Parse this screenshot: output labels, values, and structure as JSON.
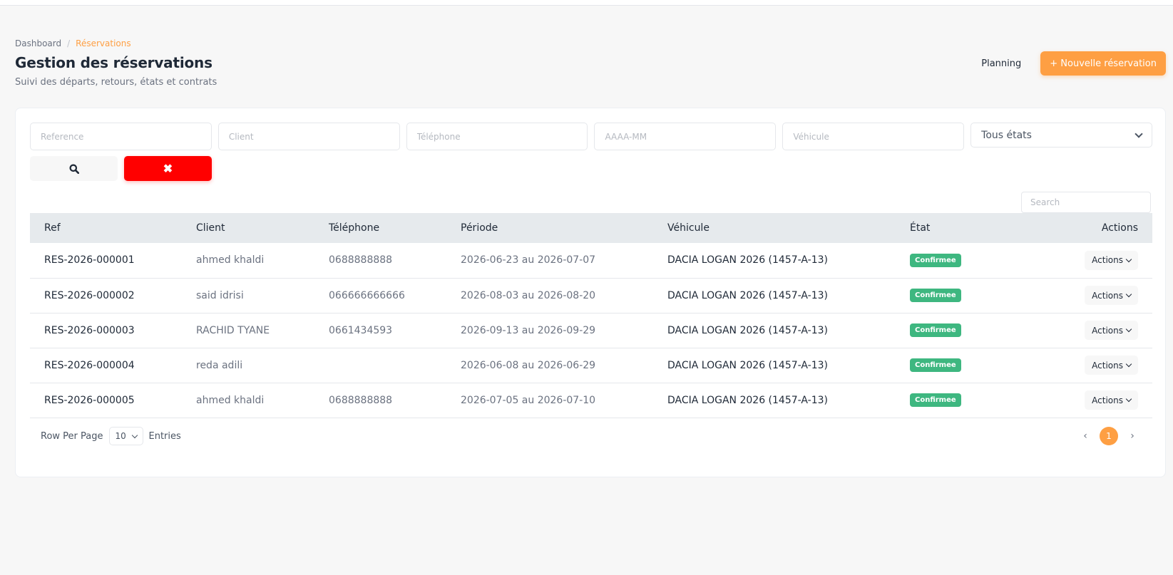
{
  "breadcrumb": {
    "home": "Dashboard",
    "separator": "/",
    "current": "Réservations"
  },
  "header": {
    "title": "Gestion des réservations",
    "subtitle": "Suivi des départs, retours, états et contrats",
    "planning_label": "Planning",
    "new_label": "+ Nouvelle réservation"
  },
  "filters": {
    "reference_placeholder": "Reference",
    "client_placeholder": "Client",
    "phone_placeholder": "Téléphone",
    "month_placeholder": "AAAA-MM",
    "vehicle_placeholder": "Véhicule",
    "state_value": "Tous états",
    "search_icon": "search-icon",
    "clear_icon": "close-icon",
    "clear_glyph": "✖"
  },
  "table": {
    "search_placeholder": "Search",
    "columns": [
      "Ref",
      "Client",
      "Téléphone",
      "Période",
      "Véhicule",
      "État",
      "Actions"
    ],
    "rows": [
      {
        "ref": "RES-2026-000001",
        "client": "ahmed khaldi",
        "phone": "0688888888",
        "period": "2026-06-23 au 2026-07-07",
        "vehicle": "DACIA LOGAN 2026 (1457-A-13)",
        "state": "Confirmee",
        "actions": "Actions"
      },
      {
        "ref": "RES-2026-000002",
        "client": "said idrisi",
        "phone": "066666666666",
        "period": "2026-08-03 au 2026-08-20",
        "vehicle": "DACIA LOGAN 2026 (1457-A-13)",
        "state": "Confirmee",
        "actions": "Actions"
      },
      {
        "ref": "RES-2026-000003",
        "client": "RACHID TYANE",
        "phone": "0661434593",
        "period": "2026-09-13 au 2026-09-29",
        "vehicle": "DACIA LOGAN 2026 (1457-A-13)",
        "state": "Confirmee",
        "actions": "Actions"
      },
      {
        "ref": "RES-2026-000004",
        "client": "reda adili",
        "phone": "",
        "period": "2026-06-08 au 2026-06-29",
        "vehicle": "DACIA LOGAN 2026 (1457-A-13)",
        "state": "Confirmee",
        "actions": "Actions"
      },
      {
        "ref": "RES-2026-000005",
        "client": "ahmed khaldi",
        "phone": "0688888888",
        "period": "2026-07-05 au 2026-07-10",
        "vehicle": "DACIA LOGAN 2026 (1457-A-13)",
        "state": "Confirmee",
        "actions": "Actions"
      }
    ]
  },
  "pagination": {
    "row_per_page_label": "Row Per Page",
    "per_page_value": "10",
    "entries_label": "Entries",
    "prev_glyph": "‹",
    "current_page": "1",
    "next_glyph": "›"
  },
  "colors": {
    "accent": "#fe9f43",
    "danger": "#ff0000",
    "success": "#3eb780",
    "table_header": "#e6eaed"
  }
}
